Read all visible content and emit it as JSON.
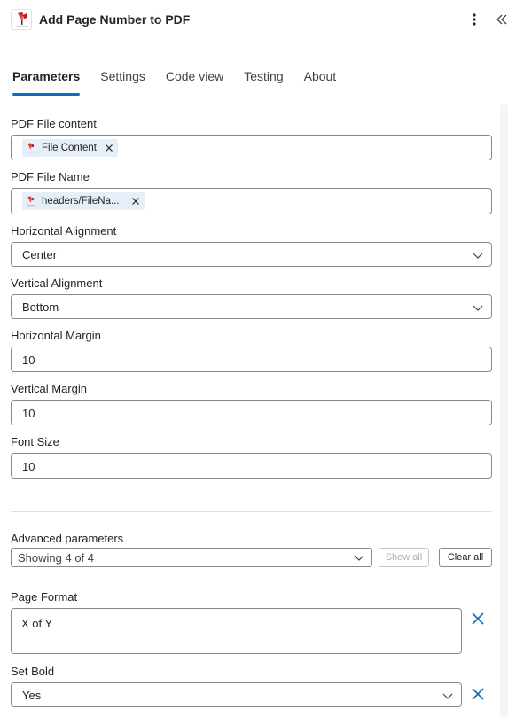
{
  "header": {
    "title": "Add Page Number to PDF",
    "more_icon": "more-vertical-icon",
    "collapse_icon": "double-chevron-left-icon",
    "app_icon": "pdf4me-logo-icon"
  },
  "tabs": [
    {
      "label": "Parameters",
      "active": true
    },
    {
      "label": "Settings",
      "active": false
    },
    {
      "label": "Code view",
      "active": false
    },
    {
      "label": "Testing",
      "active": false
    },
    {
      "label": "About",
      "active": false
    }
  ],
  "fields": {
    "pdf_file_content": {
      "label": "PDF File content",
      "token": "File Content"
    },
    "pdf_file_name": {
      "label": "PDF File Name",
      "token": "headers/FileNa..."
    },
    "horizontal_alignment": {
      "label": "Horizontal Alignment",
      "value": "Center"
    },
    "vertical_alignment": {
      "label": "Vertical Alignment",
      "value": "Bottom"
    },
    "horizontal_margin": {
      "label": "Horizontal Margin",
      "value": "10"
    },
    "vertical_margin": {
      "label": "Vertical Margin",
      "value": "10"
    },
    "font_size": {
      "label": "Font Size",
      "value": "10"
    }
  },
  "advanced": {
    "label": "Advanced parameters",
    "selected": "Showing 4 of 4",
    "show_all": "Show all",
    "clear_all": "Clear all"
  },
  "page_format": {
    "label": "Page Format",
    "value": "X of Y"
  },
  "set_bold": {
    "label": "Set Bold",
    "value": "Yes"
  },
  "colors": {
    "accent": "#0f6cbd",
    "token_bg": "#e6eef8",
    "border": "#8a8a8a"
  }
}
